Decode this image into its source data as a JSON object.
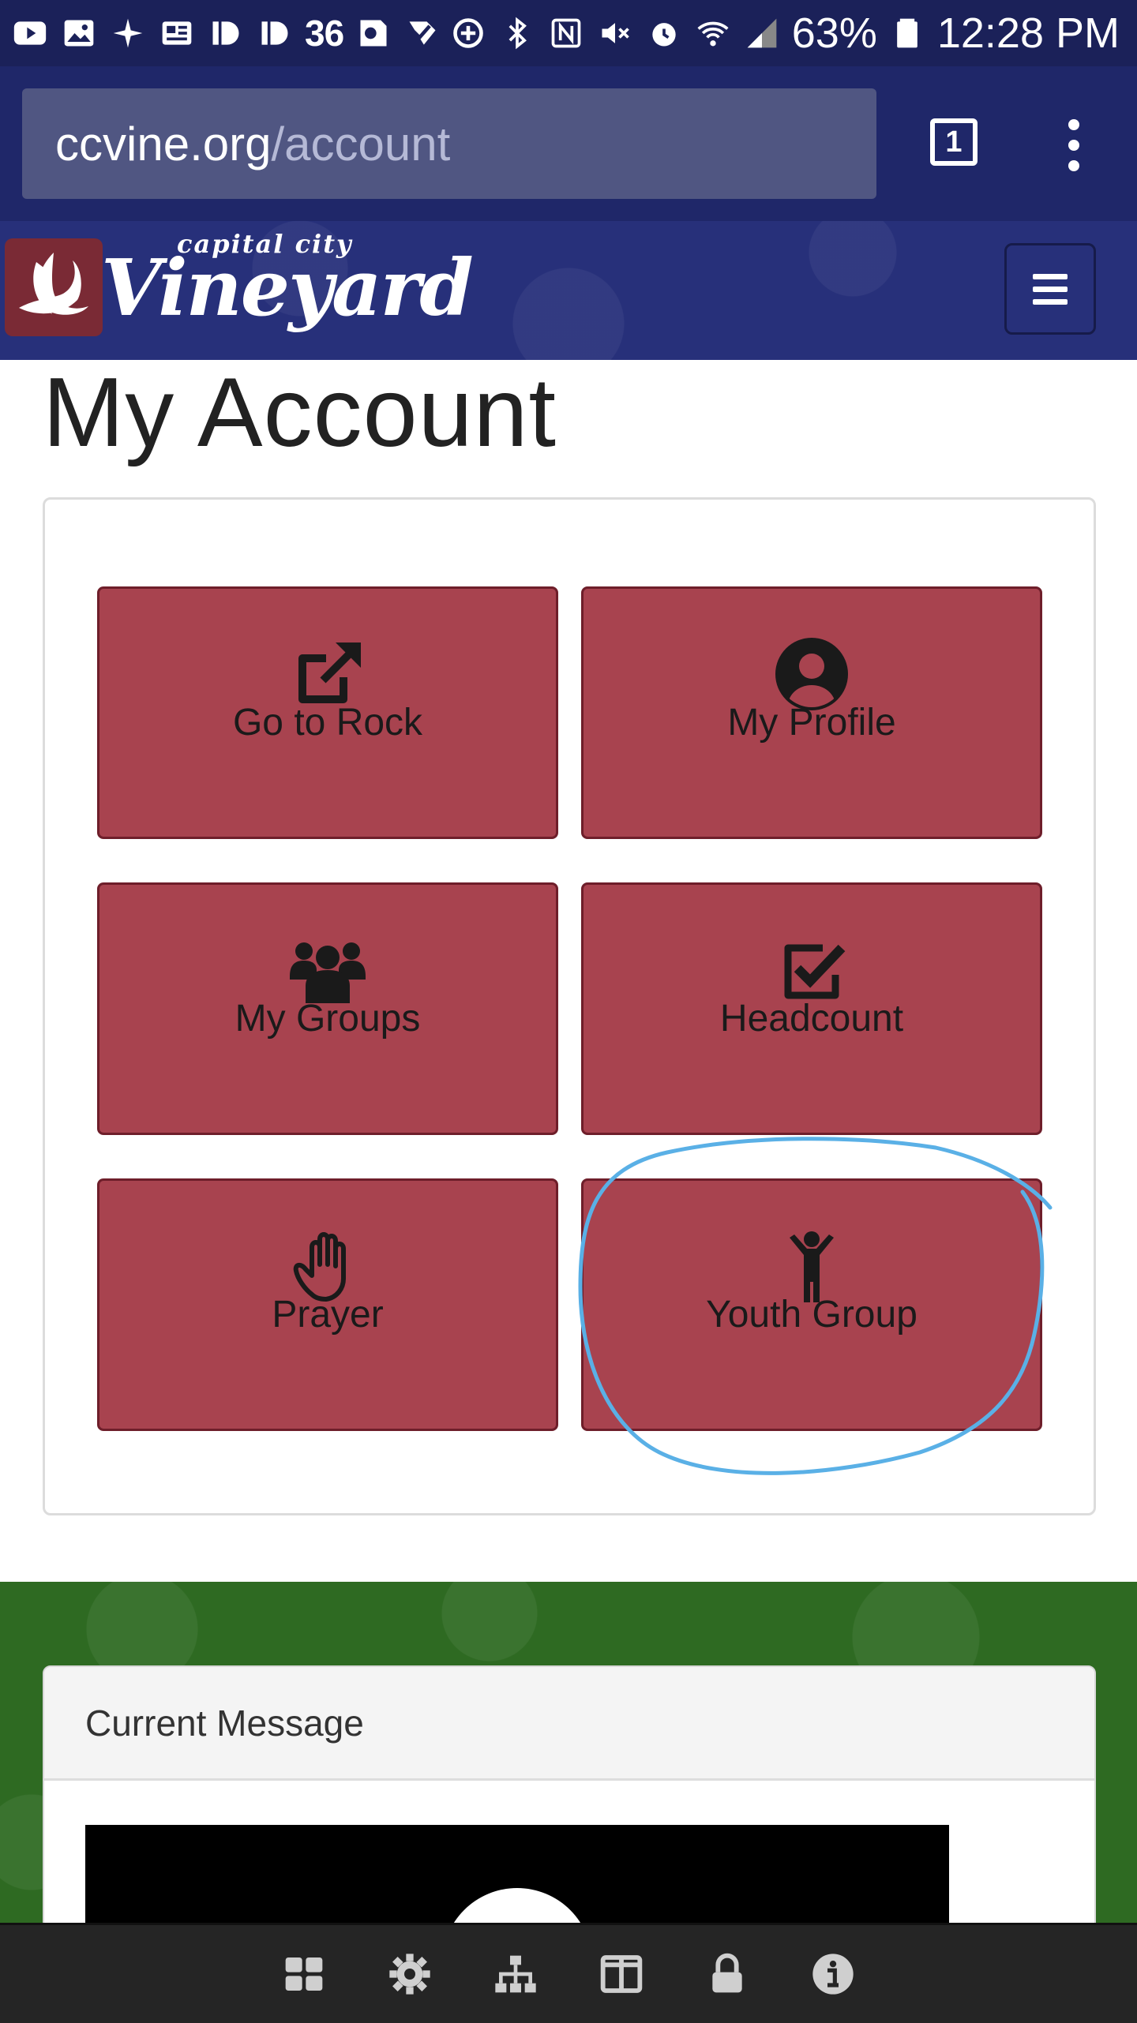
{
  "status_bar": {
    "notification_count": "36",
    "battery": "63%",
    "time": "12:28 PM"
  },
  "browser": {
    "url_host": "ccvine.org",
    "url_path": "/account",
    "tab_count": "1"
  },
  "site": {
    "logo_sub": "capital city",
    "logo_main": "Vineyard"
  },
  "page": {
    "title": "My Account"
  },
  "tiles": [
    {
      "label": "Go to Rock",
      "icon": "external-link-icon"
    },
    {
      "label": "My Profile",
      "icon": "user-circle-icon"
    },
    {
      "label": "My Groups",
      "icon": "users-icon"
    },
    {
      "label": "Headcount",
      "icon": "check-square-icon"
    },
    {
      "label": "Prayer",
      "icon": "hand-icon"
    },
    {
      "label": "Youth Group",
      "icon": "child-icon"
    }
  ],
  "current_message": {
    "heading": "Current Message"
  },
  "bottom_bar": {
    "icons": [
      "grid-icon",
      "gear-icon",
      "sitemap-icon",
      "columns-icon",
      "lock-icon",
      "info-icon"
    ]
  },
  "colors": {
    "tile_bg": "#a8434f",
    "header_blue": "#27307a",
    "footer_green": "#2e6a22",
    "annotation_blue": "#5ab0e6"
  }
}
